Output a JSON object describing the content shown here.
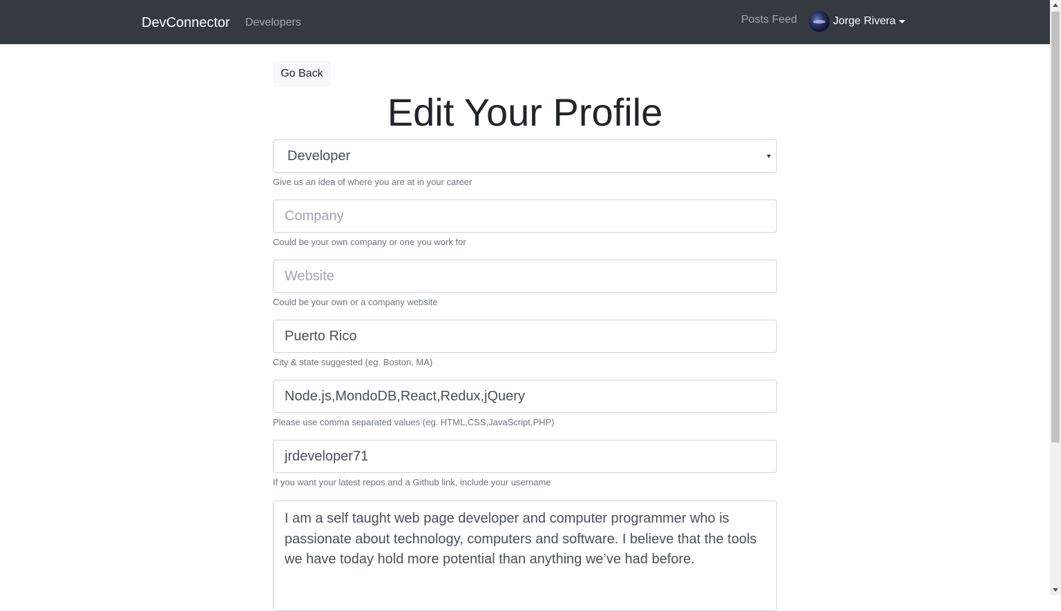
{
  "navbar": {
    "brand": "DevConnector",
    "developers_link": "Developers",
    "posts_feed_link": "Posts Feed",
    "user_name": "Jorge Rivera"
  },
  "page": {
    "go_back_label": "Go Back",
    "title": "Edit Your Profile"
  },
  "form": {
    "status": {
      "value": "Developer",
      "help": "Give us an idea of where you are at in your career"
    },
    "company": {
      "value": "",
      "placeholder": "Company",
      "help": "Could be your own company or one you work for"
    },
    "website": {
      "value": "",
      "placeholder": "Website",
      "help": "Could be your own or a company website"
    },
    "location": {
      "value": "Puerto Rico",
      "help": "City & state suggested (eg. Boston, MA)"
    },
    "skills": {
      "value": "Node.js,MondoDB,React,Redux,jQuery",
      "help": "Please use comma separated values (eg. HTML,CSS,JavaScript,PHP)"
    },
    "github": {
      "value": "jrdeveloper71",
      "help": "If you want your latest repos and a Github link, include your username"
    },
    "bio": {
      "value": "I am a self taught web page developer and computer programmer who is passionate about technology, computers and software. I believe that the tools we have today hold more potential than anything we’ve had before."
    }
  },
  "icons": {
    "user_caret": "caret-down-icon",
    "select_arrow": "chevron-down-icon"
  },
  "colors": {
    "navbar_bg": "#343a40",
    "muted_text": "#6c757d",
    "border": "#ced4da"
  }
}
